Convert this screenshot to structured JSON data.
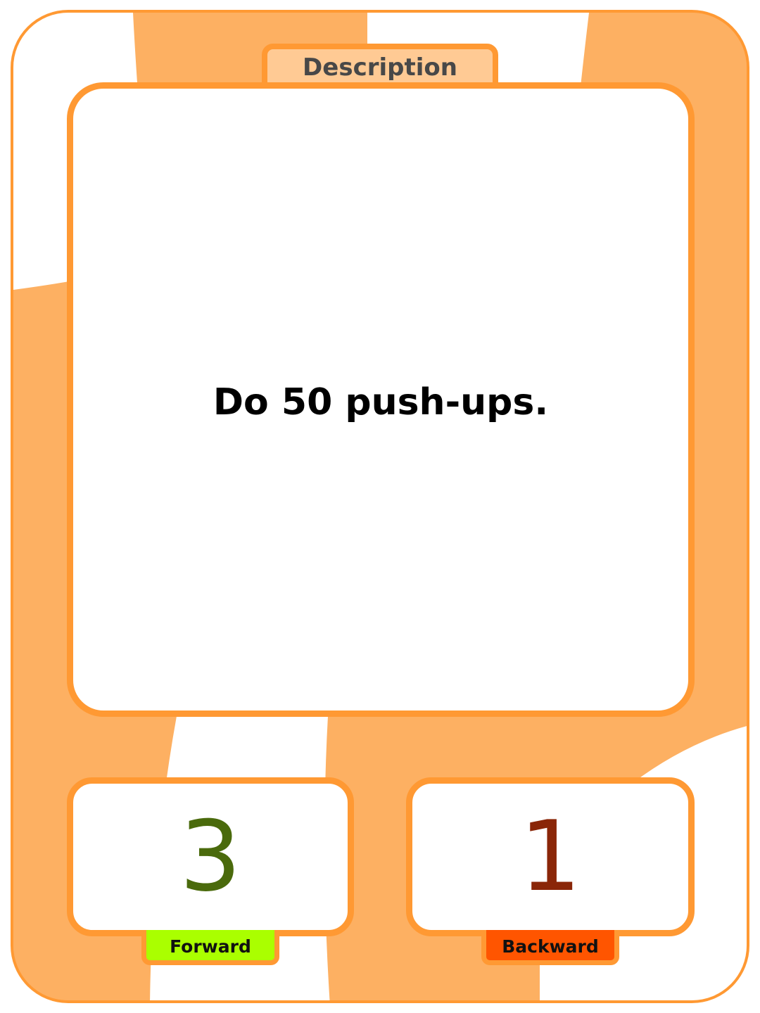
{
  "card": {
    "tab_label": "Description",
    "description": "Do 50 push-ups.",
    "forward": {
      "value": "3",
      "label": "Forward",
      "label_color": "#aaff00",
      "number_color": "#4a6a0c"
    },
    "backward": {
      "value": "1",
      "label": "Backward",
      "label_color": "#ff5500",
      "number_color": "#8a2608"
    },
    "colors": {
      "border": "#ff9933",
      "background": "#fdb062",
      "tab": "#ffca94"
    }
  }
}
